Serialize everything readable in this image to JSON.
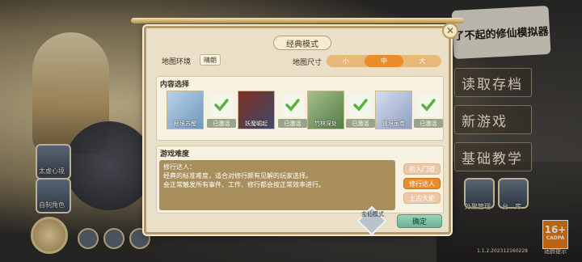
{
  "background": {
    "menu_buttons": [
      "读取存档",
      "新游戏",
      "基础教学"
    ],
    "left_cards": [
      {
        "label": "太虚心境"
      },
      {
        "label": "自制角色"
      }
    ],
    "logo_text": "了不起的修仙模拟器",
    "right_cards": [
      {
        "label": "外聚管理"
      },
      {
        "label": "台…库"
      }
    ],
    "age_rating": "16+",
    "age_rating_sub": "CADPA",
    "age_note": "适龄提示",
    "version": "1.1.2.202312160228"
  },
  "dialog": {
    "title": "经典模式",
    "close_label": "✕",
    "map_env_label": "地图环境",
    "map_env_value": "晴朗",
    "map_size_label": "地图尺寸",
    "map_sizes": [
      {
        "label": "小",
        "active": false
      },
      {
        "label": "中",
        "active": true
      },
      {
        "label": "大",
        "active": false
      }
    ],
    "content_section_title": "内容选择",
    "content_cards": [
      {
        "name": "秘境苏醒",
        "status": "已激活",
        "color": "#7ea6c8"
      },
      {
        "name": "妖魔崛起",
        "status": "已激活",
        "color": "#a2432f"
      },
      {
        "name": "竹林深处",
        "status": "已激活",
        "color": "#8aa36a"
      },
      {
        "name": "道境画卷",
        "status": "已激活",
        "color": "#9aa8c6"
      },
      {
        "name": "",
        "status": "已激活",
        "color": "#c9b27a"
      }
    ],
    "difficulty_section_title": "游戏难度",
    "difficulty_desc_title": "修行达人：",
    "difficulty_desc_line1": "经典的标准难度，适合对修行颇有见解的玩家选择。",
    "difficulty_desc_line2": "会正常触发所有事件、工作、修行都会按正常效率进行。",
    "difficulty_options": [
      {
        "label": "初入门道",
        "active": false
      },
      {
        "label": "修行达人",
        "active": true
      },
      {
        "label": "上古大能",
        "active": false
      }
    ],
    "mode_tag": "金仙模式",
    "confirm_label": "确定"
  }
}
